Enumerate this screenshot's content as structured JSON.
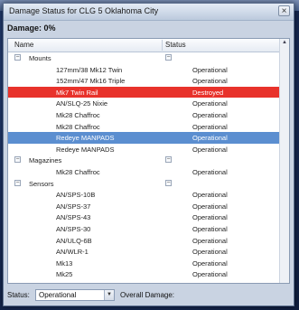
{
  "window": {
    "title": "Damage Status for CLG 5 Oklahoma City",
    "close_glyph": "×"
  },
  "damage": {
    "label": "Damage:",
    "value": "0%"
  },
  "grid": {
    "columns": {
      "name": "Name",
      "status": "Status"
    },
    "rows": [
      {
        "type": "group",
        "name": "Mounts",
        "status": "",
        "toggle": "−",
        "status_toggle": "−"
      },
      {
        "type": "item",
        "name": "127mm/38 Mk12 Twin",
        "status": "Operational"
      },
      {
        "type": "item",
        "name": "152mm/47 Mk16 Triple",
        "status": "Operational"
      },
      {
        "type": "item",
        "name": "Mk7 Twin Rail",
        "status": "Destroyed",
        "state": "destroyed"
      },
      {
        "type": "item",
        "name": "AN/SLQ-25 Nixie",
        "status": "Operational"
      },
      {
        "type": "item",
        "name": "Mk28 Chaffroc",
        "status": "Operational"
      },
      {
        "type": "item",
        "name": "Mk28 Chaffroc",
        "status": "Operational"
      },
      {
        "type": "item",
        "name": "Redeye MANPADS",
        "status": "Operational",
        "state": "selected"
      },
      {
        "type": "item",
        "name": "Redeye MANPADS",
        "status": "Operational"
      },
      {
        "type": "group",
        "name": "Magazines",
        "status": "",
        "toggle": "−",
        "status_toggle": "−"
      },
      {
        "type": "item",
        "name": "Mk28 Chaffroc",
        "status": "Operational"
      },
      {
        "type": "group",
        "name": "Sensors",
        "status": "",
        "toggle": "−",
        "status_toggle": "−"
      },
      {
        "type": "item",
        "name": "AN/SPS-10B",
        "status": "Operational"
      },
      {
        "type": "item",
        "name": "AN/SPS-37",
        "status": "Operational"
      },
      {
        "type": "item",
        "name": "AN/SPS-43",
        "status": "Operational"
      },
      {
        "type": "item",
        "name": "AN/SPS-30",
        "status": "Operational"
      },
      {
        "type": "item",
        "name": "AN/ULQ-6B",
        "status": "Operational"
      },
      {
        "type": "item",
        "name": "AN/WLR-1",
        "status": "Operational"
      },
      {
        "type": "item",
        "name": "Mk13",
        "status": "Operational"
      },
      {
        "type": "item",
        "name": "Mk25",
        "status": "Operational"
      }
    ]
  },
  "footer": {
    "status_label": "Status:",
    "status_value": "Operational",
    "overall_label": "Overall Damage:"
  },
  "colors": {
    "destroyed": "#e8322b",
    "selected": "#5b8ed0"
  },
  "icons": {
    "close": "close-icon",
    "toggle": "collapse-toggle-icon",
    "dropdown": "chevron-down-icon",
    "scroll_up": "scroll-up-arrow-icon"
  }
}
